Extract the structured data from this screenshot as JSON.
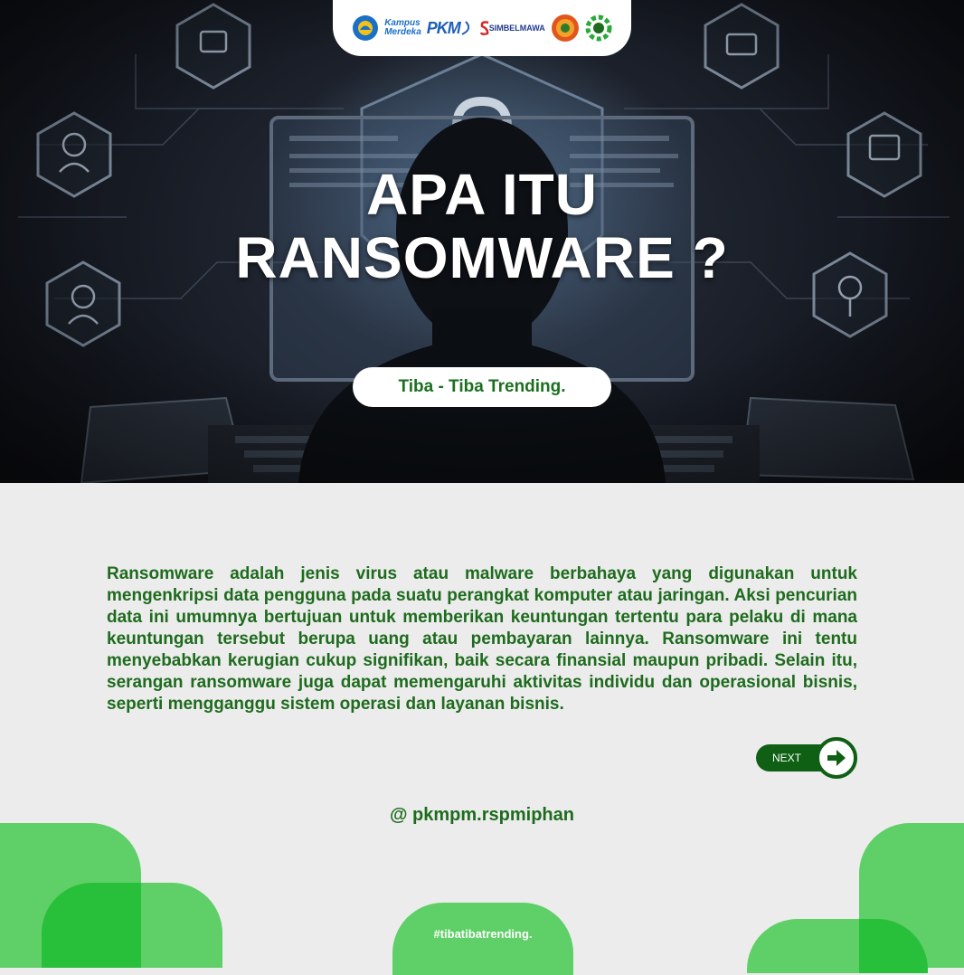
{
  "logos": {
    "kampus_merdeka_line1": "Kampus",
    "kampus_merdeka_line2": "Merdeka",
    "pkm": "PKM",
    "simbelmawa": "SIMBELMAWA"
  },
  "hero": {
    "title_line1": "APA ITU",
    "title_line2": "RANSOMWARE ?",
    "tagline": "Tiba - Tiba Trending."
  },
  "body": {
    "paragraph": "Ransomware adalah jenis virus atau malware berbahaya yang digunakan untuk mengenkripsi data pengguna pada suatu perangkat komputer atau jaringan. Aksi pencurian data ini umumnya bertujuan untuk memberikan keuntungan tertentu para pelaku di mana keuntungan tersebut berupa uang atau pembayaran lainnya. Ransomware ini tentu menyebabkan kerugian cukup signifikan, baik secara finansial maupun pribadi. Selain itu, serangan ransomware juga dapat memengaruhi aktivitas individu dan operasional bisnis, seperti mengganggu sistem operasi dan layanan bisnis."
  },
  "next_button": {
    "label": "NEXT"
  },
  "footer": {
    "handle": "@ pkmpm.rspmiphan",
    "hashtag": "#tibatibatrending."
  },
  "colors": {
    "primary_green": "#1e6b1e",
    "dark_green": "#0f5f14",
    "light_green": "#5fcf67",
    "bright_green": "#28c03a",
    "background": "#ececec"
  },
  "icons": [
    "tut-wuri-handayani-icon",
    "university-seal-icon",
    "gear-logo-icon",
    "arrow-right-icon",
    "padlock-icon"
  ]
}
